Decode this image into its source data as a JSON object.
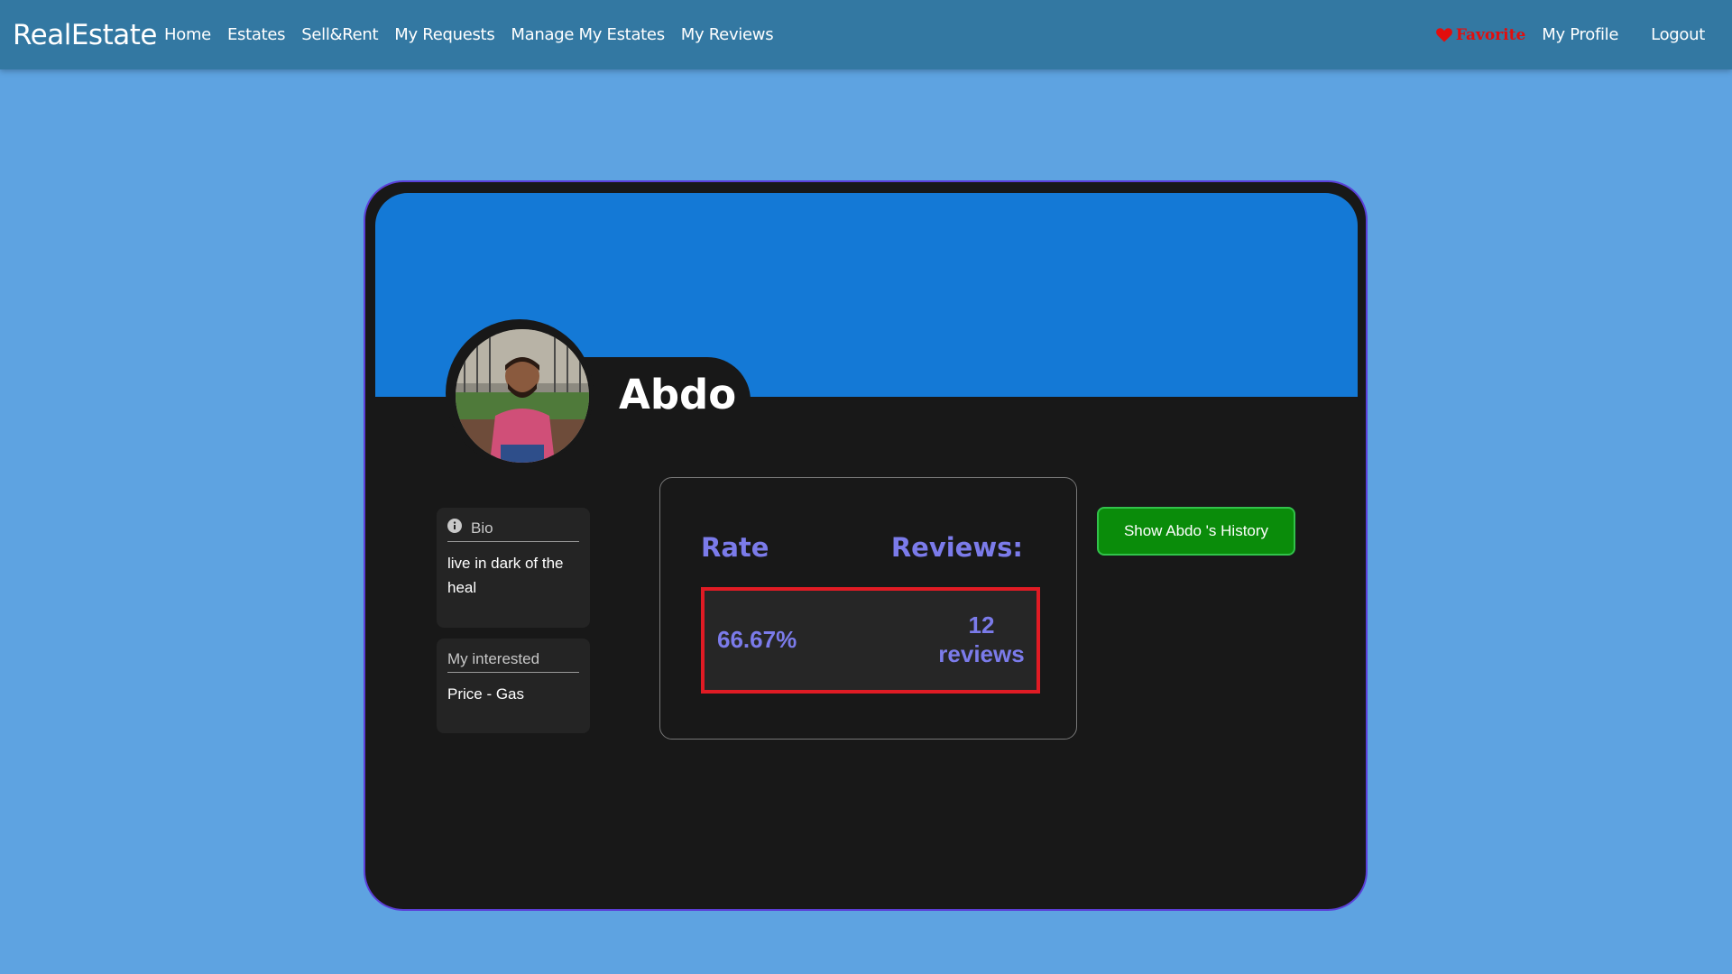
{
  "navbar": {
    "brand": "RealEstate",
    "links": [
      "Home",
      "Estates",
      "Sell&Rent",
      "My Requests",
      "Manage My Estates",
      "My Reviews"
    ],
    "favorite_label": "Favorite",
    "favorite_icon": "heart-icon",
    "profile_label": "My Profile",
    "logout_label": "Logout"
  },
  "profile": {
    "name": "Abdo",
    "avatar_alt": "profile photo",
    "bio": {
      "title": "Bio",
      "icon": "info-icon",
      "text": "live in dark of the heal"
    },
    "interests": {
      "title": "My interested",
      "text": "Price - Gas"
    }
  },
  "stats": {
    "rate_label": "Rate",
    "reviews_label": "Reviews:",
    "rate_value": "66.67%",
    "reviews_count": "12",
    "reviews_unit": "reviews"
  },
  "history_button": "Show Abdo 's History",
  "colors": {
    "page_bg": "#5ea3e1",
    "navbar_bg": "#3378a2",
    "banner": "#1479d6",
    "card_bg": "#181818",
    "accent_text": "#7b7bea",
    "favorite": "#e30d0d",
    "button_green": "#0a8c0a",
    "highlight_border": "#e01b24"
  }
}
